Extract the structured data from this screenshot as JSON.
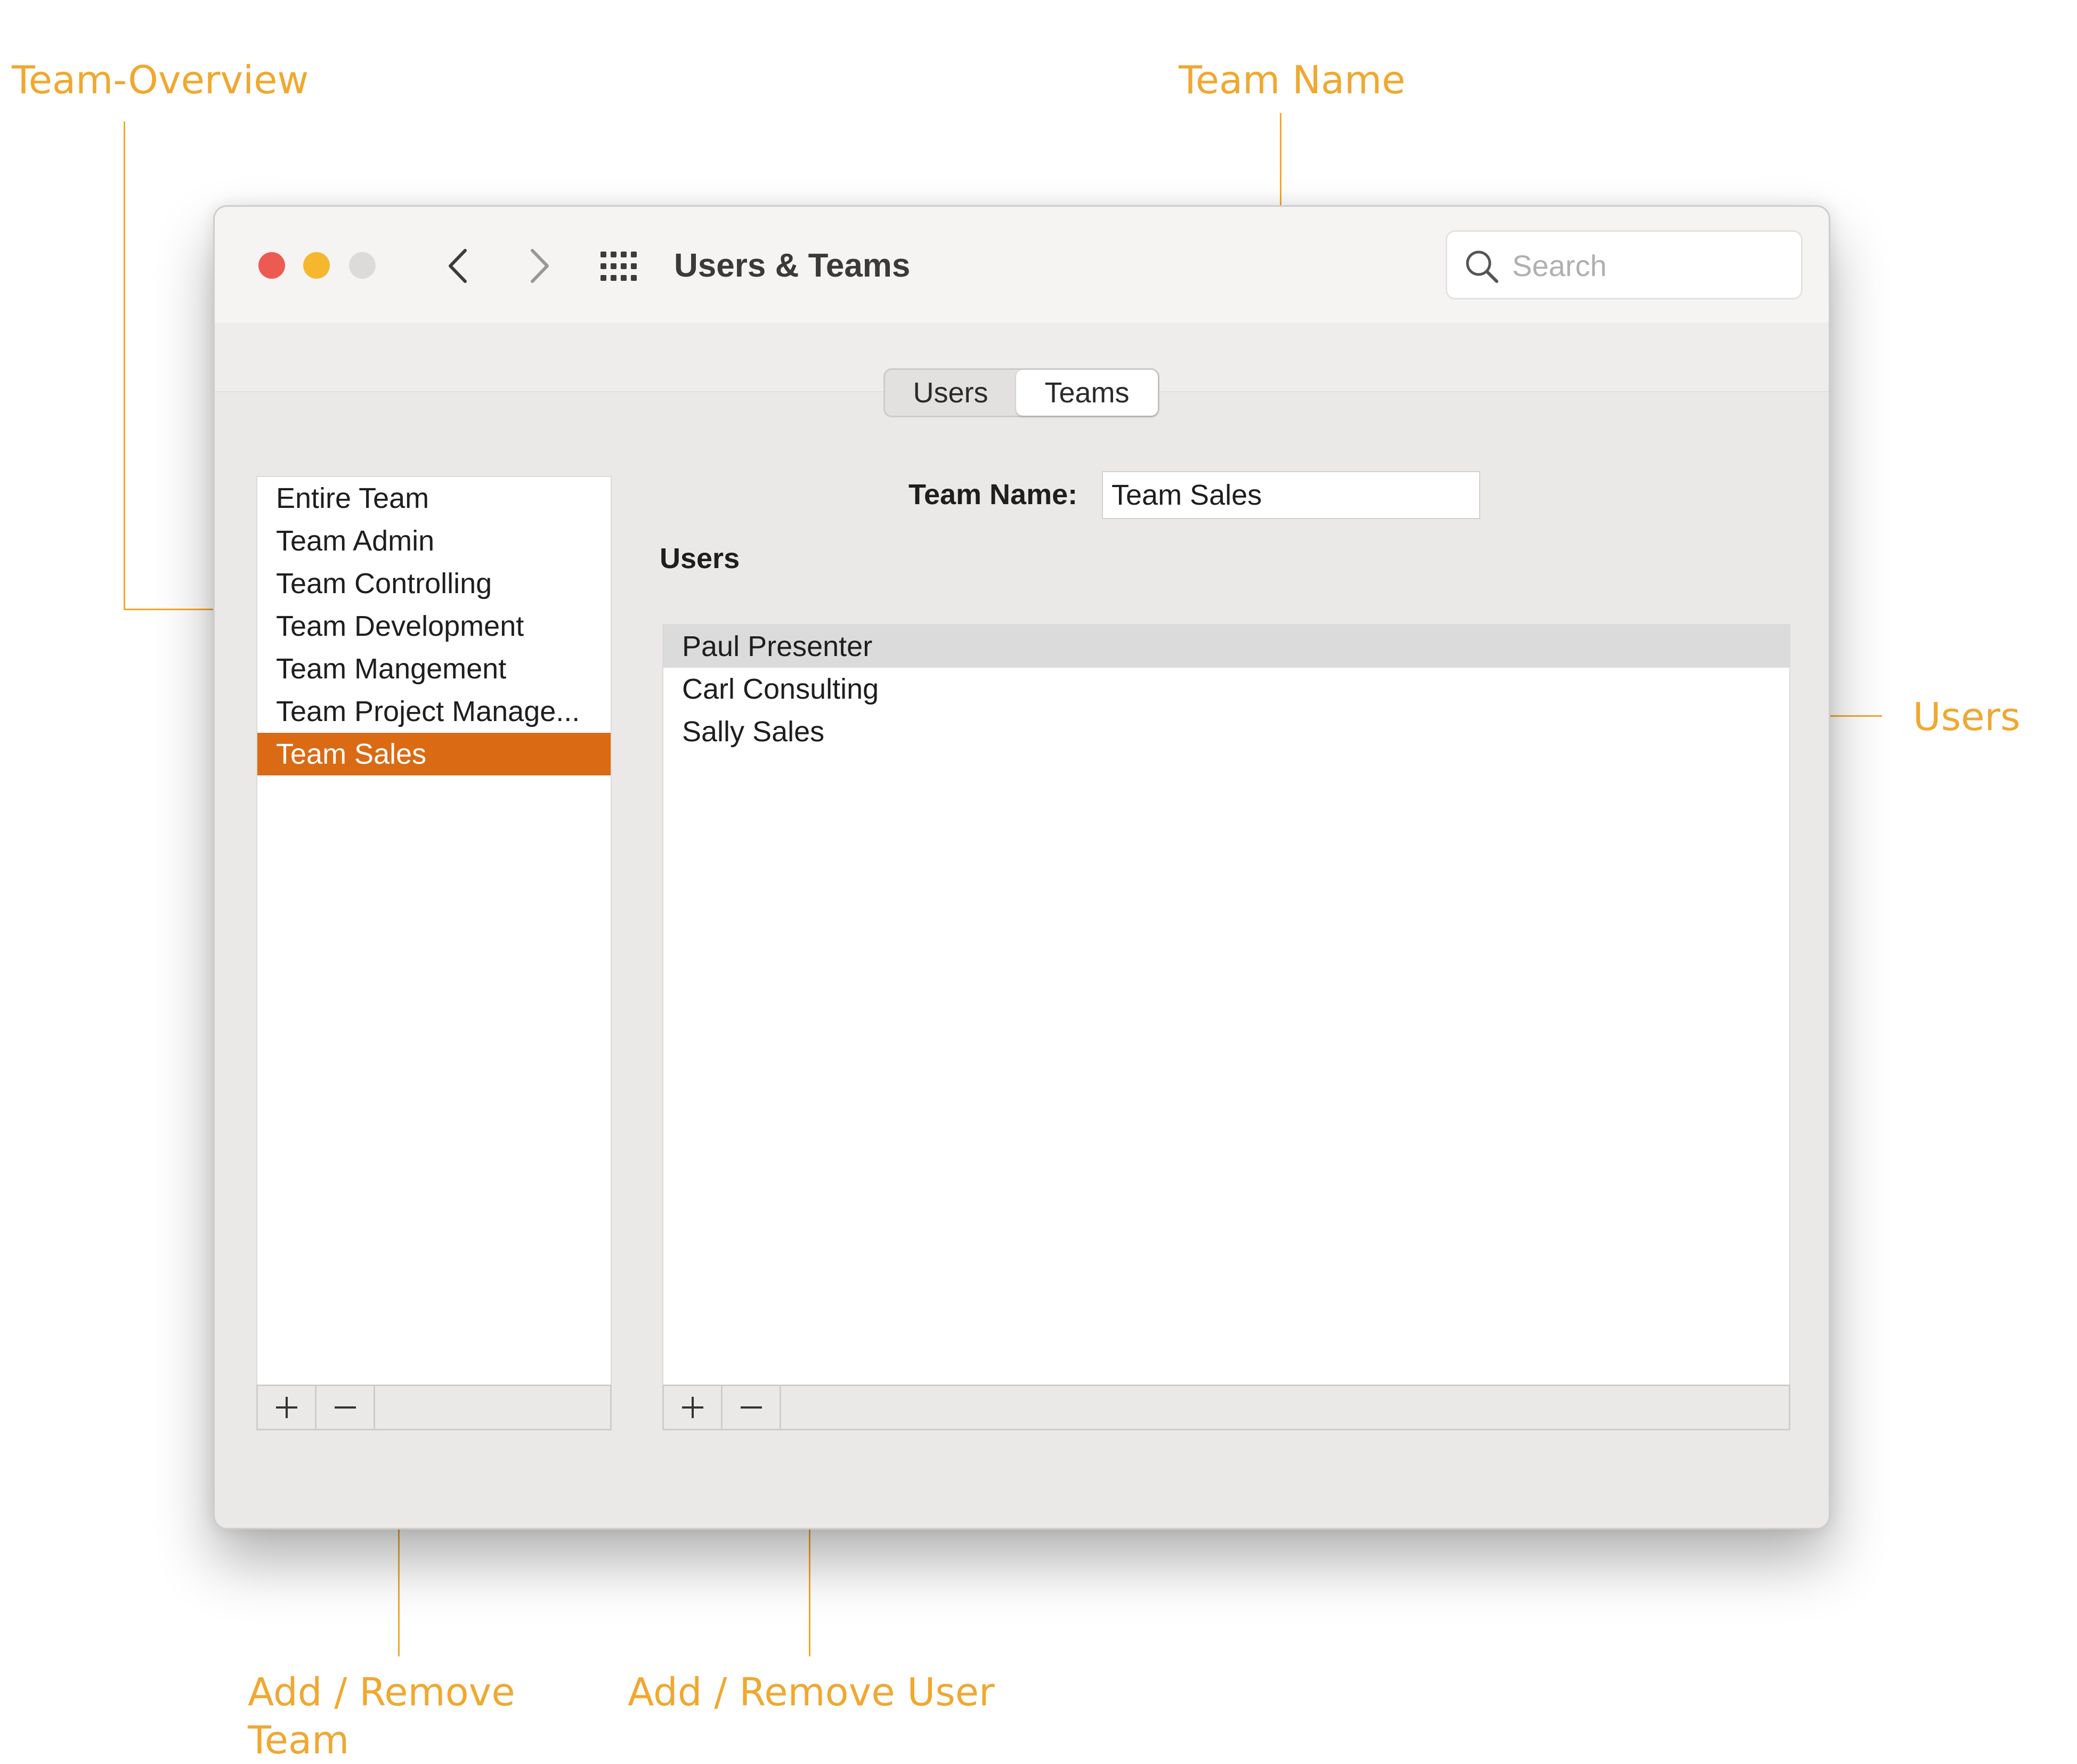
{
  "annotations": {
    "team_overview": "Team-Overview",
    "team_name": "Team Name",
    "users": "Users",
    "add_remove_team": "Add / Remove",
    "add_remove_team_line2": "Team",
    "add_remove_user": "Add / Remove User",
    "color": "#f0a830"
  },
  "window": {
    "title": "Users & Teams",
    "search_placeholder": "Search",
    "icons": [
      "close-button",
      "minimize-button",
      "zoom-button",
      "chevron-left-icon",
      "chevron-right-icon",
      "grid-icon",
      "search-icon"
    ]
  },
  "segmented": {
    "users_label": "Users",
    "teams_label": "Teams",
    "selected": "Teams"
  },
  "teams": {
    "items": [
      "Entire Team",
      "Team Admin",
      "Team Controlling",
      "Team Development",
      "Team Mangement",
      "Team Project Manage...",
      "Team Sales"
    ],
    "selected_index": 6,
    "selection_color": "#da6b14"
  },
  "detail": {
    "team_name_label": "Team Name:",
    "team_name_value": "Team Sales",
    "users_heading": "Users",
    "users": [
      "Paul Presenter",
      "Carl Consulting",
      "Sally Sales"
    ],
    "highlighted_index": 0
  }
}
